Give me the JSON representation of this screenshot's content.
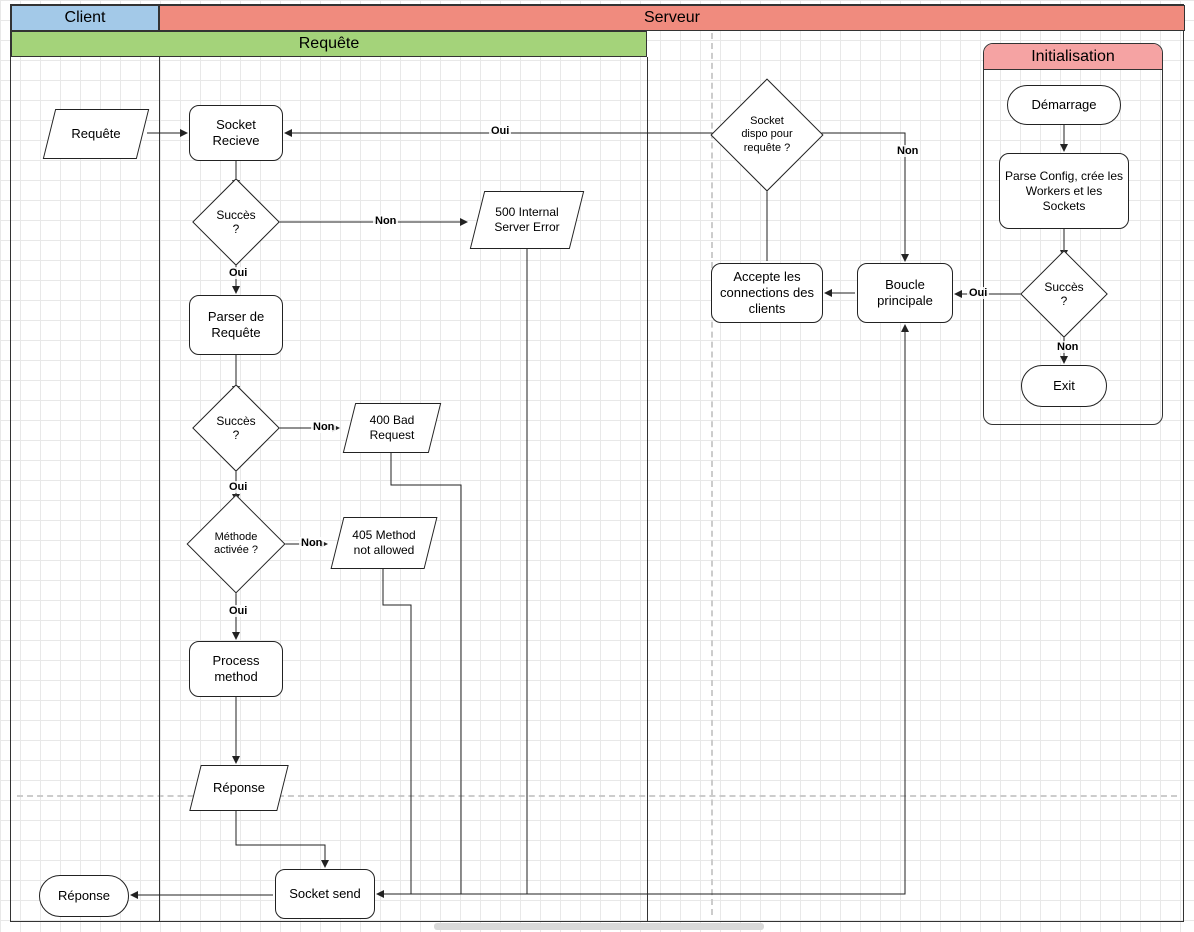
{
  "lanes": {
    "client": "Client",
    "server": "Serveur",
    "requete": "Requête",
    "init": "Initialisation"
  },
  "nodes": {
    "requete_in": "Requête",
    "socket_recv": "Socket Recieve",
    "succ1": "Succès ?",
    "err500": "500 Internal Server Error",
    "parser": "Parser de Requête",
    "succ2": "Succès ?",
    "err400": "400 Bad Request",
    "method_q": "Méthode activée ?",
    "err405": "405 Method not allowed",
    "process": "Process method",
    "reponse_msg": "Réponse",
    "socket_send": "Socket send",
    "reponse_out": "Réponse",
    "socket_dispo": "Socket dispo pour requête ?",
    "accept": "Accepte les connections des clients",
    "boucle": "Boucle principale",
    "demarrage": "Démarrage",
    "parse_config": "Parse Config, crée les Workers et les Sockets",
    "succ3": "Succès ?",
    "exit": "Exit"
  },
  "edges": {
    "oui": "Oui",
    "non": "Non"
  }
}
